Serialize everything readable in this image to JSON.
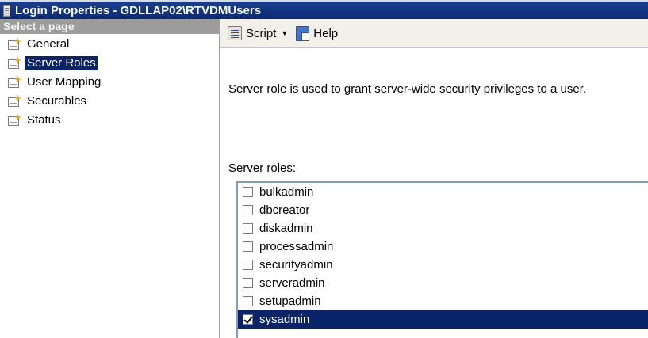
{
  "window": {
    "title": "Login Properties - GDLLAP02\\RTVDMUsers"
  },
  "left_pane": {
    "header": "Select a page",
    "pages": [
      {
        "label": "General",
        "selected": false
      },
      {
        "label": "Server Roles",
        "selected": true
      },
      {
        "label": "User Mapping",
        "selected": false
      },
      {
        "label": "Securables",
        "selected": false
      },
      {
        "label": "Status",
        "selected": false
      }
    ]
  },
  "toolbar": {
    "script_label": "Script",
    "help_label": "Help"
  },
  "content": {
    "description": "Server role is used to grant server-wide security privileges to a user.",
    "roles_label_mnemonic": "S",
    "roles_label_rest": "erver roles:",
    "roles": [
      {
        "label": "bulkadmin",
        "checked": false,
        "selected": false
      },
      {
        "label": "dbcreator",
        "checked": false,
        "selected": false
      },
      {
        "label": "diskadmin",
        "checked": false,
        "selected": false
      },
      {
        "label": "processadmin",
        "checked": false,
        "selected": false
      },
      {
        "label": "securityadmin",
        "checked": false,
        "selected": false
      },
      {
        "label": "serveradmin",
        "checked": false,
        "selected": false
      },
      {
        "label": "setupadmin",
        "checked": false,
        "selected": false
      },
      {
        "label": "sysadmin",
        "checked": true,
        "selected": true
      }
    ]
  },
  "colors": {
    "selection": "#0a246a",
    "titlebar": "#0a2a74",
    "header_gray": "#9c9c9c"
  }
}
